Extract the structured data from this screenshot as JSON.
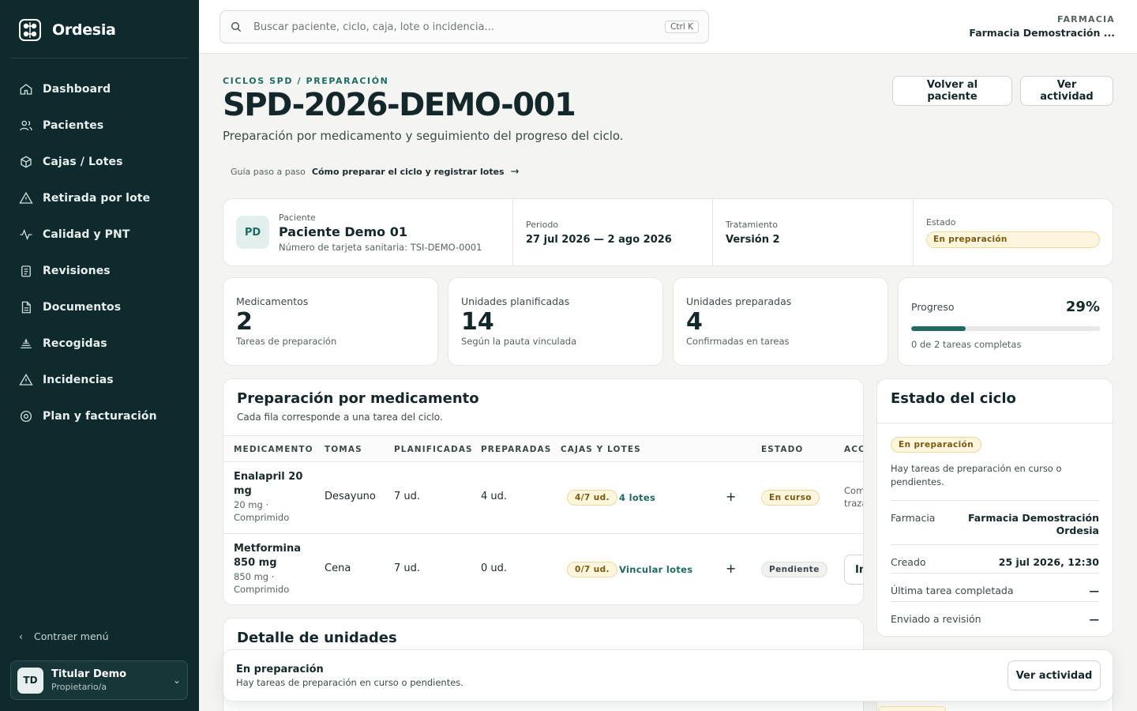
{
  "brand": {
    "name": "Ordesia"
  },
  "sidebar": {
    "items": [
      {
        "label": "Dashboard",
        "icon": "home-icon"
      },
      {
        "label": "Pacientes",
        "icon": "users-icon"
      },
      {
        "label": "Cajas / Lotes",
        "icon": "box-icon"
      },
      {
        "label": "Retirada por lote",
        "icon": "warning-icon"
      },
      {
        "label": "Calidad y PNT",
        "icon": "activity-icon"
      },
      {
        "label": "Revisiones",
        "icon": "clipboard-icon"
      },
      {
        "label": "Documentos",
        "icon": "document-icon"
      },
      {
        "label": "Recogidas",
        "icon": "pickup-icon"
      },
      {
        "label": "Incidencias",
        "icon": "warning-icon"
      },
      {
        "label": "Plan y facturación",
        "icon": "settings-icon"
      }
    ],
    "collapse_label": "Contraer menú",
    "user": {
      "initials": "TD",
      "name": "Titular Demo",
      "role": "Propietario/a"
    }
  },
  "topbar": {
    "search_placeholder": "Buscar paciente, ciclo, caja, lote o incidencia...",
    "shortcut": "Ctrl K",
    "org_label": "FARMACIA",
    "org_name": "Farmacia Demostración ..."
  },
  "header": {
    "eyebrow": "CICLOS SPD / PREPARACIÓN",
    "title": "SPD-2026-DEMO-001",
    "subtitle": "Preparación por medicamento y seguimiento del progreso del ciclo.",
    "guide_prefix": "Guía paso a paso",
    "guide_link": "Cómo preparar el ciclo y registrar lotes",
    "btn_back": "Volver al paciente",
    "btn_activity": "Ver actividad"
  },
  "patient_card": {
    "initials": "PD",
    "patient_label": "Paciente",
    "patient_name": "Paciente Demo 01",
    "patient_id": "Número de tarjeta sanitaria: TSI-DEMO-0001",
    "period_label": "Periodo",
    "period_value": "27 jul 2026 — 2 ago 2026",
    "treatment_label": "Tratamiento",
    "treatment_value": "Versión 2",
    "status_label": "Estado",
    "status_value": "En preparación"
  },
  "stats": [
    {
      "label": "Medicamentos",
      "value": "2",
      "sub": "Tareas de preparación"
    },
    {
      "label": "Unidades planificadas",
      "value": "14",
      "sub": "Según la pauta vinculada"
    },
    {
      "label": "Unidades preparadas",
      "value": "4",
      "sub": "Confirmadas en tareas"
    }
  ],
  "progress": {
    "label": "Progreso",
    "pct_text": "29%",
    "fraction": 0.29,
    "sub": "0 de 2 tareas completas"
  },
  "table": {
    "title": "Preparación por medicamento",
    "subtitle": "Cada fila corresponde a una tarea del ciclo.",
    "columns": [
      "MEDICAMENTO",
      "TOMAS",
      "PLANIFICADAS",
      "PREPARADAS",
      "CAJAS Y LOTES",
      "ESTADO",
      "ACCIONES"
    ],
    "rows": [
      {
        "name": "Enalapril 20 mg",
        "detail": "20 mg · Comprimido",
        "toma": "Desayuno",
        "planned": "7 ud.",
        "prepared": "4 ud.",
        "units": "4/7 ud.",
        "lots": "4 lotes",
        "add": "+",
        "status": "En curso",
        "action": "Completar trazabilidad"
      },
      {
        "name": "Metformina 850 mg",
        "detail": "850 mg · Comprimido",
        "toma": "Cena",
        "planned": "7 ud.",
        "prepared": "0 ud.",
        "units": "0/7 ud.",
        "lots": "Vincular lotes",
        "add": "+",
        "status": "Pendiente",
        "action": "Iniciar"
      }
    ]
  },
  "cycle_status": {
    "title": "Estado del ciclo",
    "status": "En preparación",
    "description": "Hay tareas de preparación en curso o pendientes.",
    "rows": [
      {
        "key": "Farmacia",
        "value": "Farmacia Demostración Ordesia"
      },
      {
        "key": "Creado",
        "value": "25 jul 2026, 12:30"
      },
      {
        "key": "Última tarea completada",
        "value": "—"
      },
      {
        "key": "Enviado a revisión",
        "value": "—"
      }
    ]
  },
  "detail": {
    "title": "Detalle de unidades"
  },
  "floating_bar": {
    "title": "En preparación",
    "subtitle": "Hay tareas de preparación en curso o pendientes.",
    "button": "Ver actividad"
  }
}
